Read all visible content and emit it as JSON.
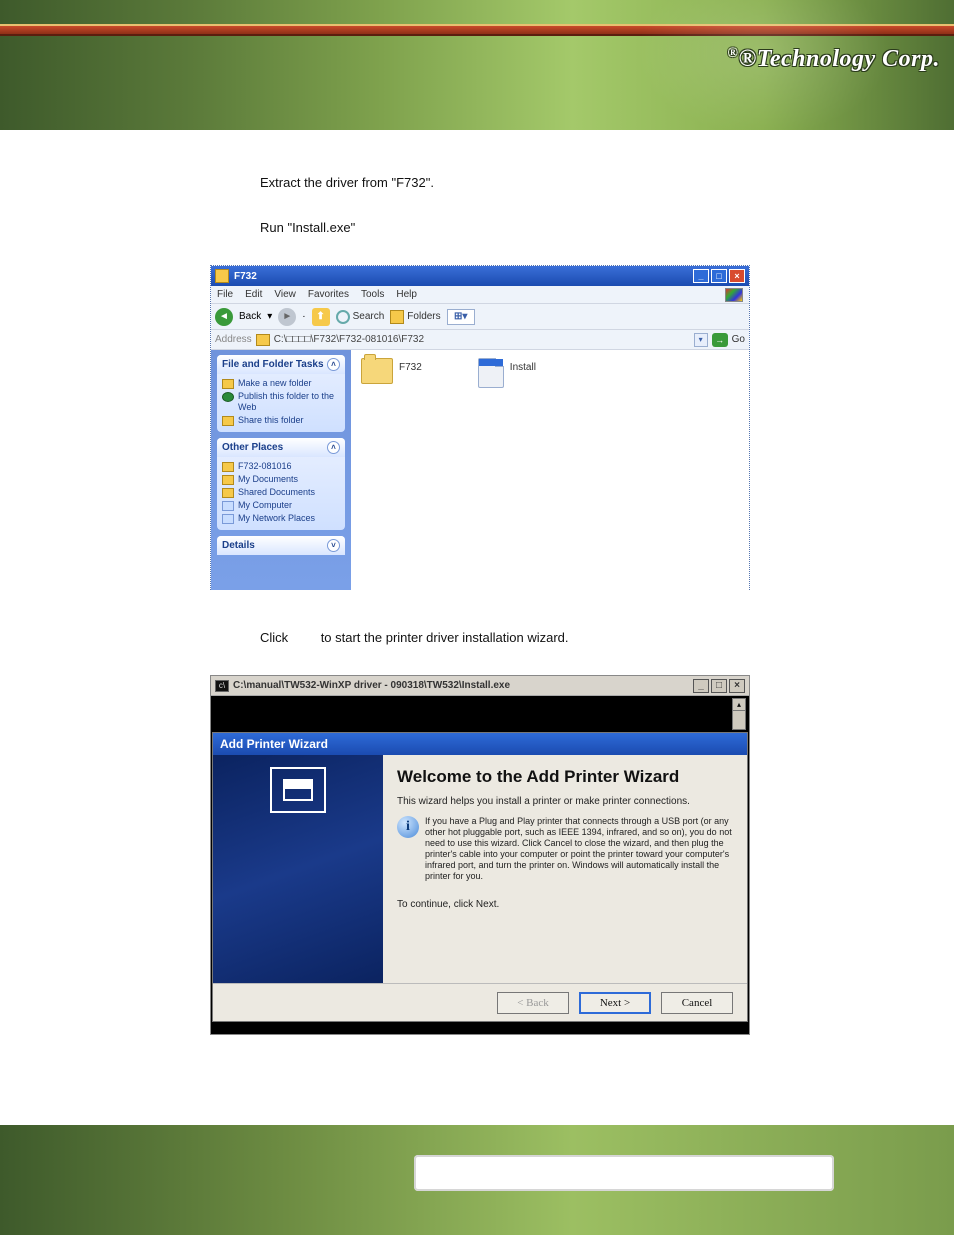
{
  "header": {
    "brand": "®Technology Corp."
  },
  "steps": {
    "extract": "Extract the driver from \"F732\".",
    "run": "Run \"Install.exe\"",
    "click_before": "Click",
    "click_after": "to start the printer driver installation wizard."
  },
  "explorer": {
    "title": "F732",
    "menus": [
      "File",
      "Edit",
      "View",
      "Favorites",
      "Tools",
      "Help"
    ],
    "toolbar": {
      "back": "Back",
      "search": "Search",
      "folders": "Folders",
      "views": "⦿"
    },
    "address": {
      "label": "Address",
      "path": "C:\\□□□□\\F732\\F732-081016\\F732",
      "go": "Go"
    },
    "panels": {
      "tasks": {
        "title": "File and Folder Tasks",
        "items": [
          "Make a new folder",
          "Publish this folder to the Web",
          "Share this folder"
        ]
      },
      "places": {
        "title": "Other Places",
        "items": [
          "F732-081016",
          "My Documents",
          "Shared Documents",
          "My Computer",
          "My Network Places"
        ]
      },
      "details": {
        "title": "Details"
      }
    },
    "items": {
      "folder": "F732",
      "exe": "Install"
    }
  },
  "cmd": {
    "title": "C:\\manual\\TW532-WinXP driver - 090318\\TW532\\Install.exe"
  },
  "wizard": {
    "header": "Add Printer Wizard",
    "welcome": "Welcome to the Add Printer Wizard",
    "intro": "This wizard helps you install a printer or make printer connections.",
    "info": "If you have a Plug and Play printer that connects through a USB port (or any other hot pluggable port, such as IEEE 1394, infrared, and so on), you do not need to use this wizard. Click Cancel to close the wizard, and then plug the printer's cable into your computer or point the printer toward your computer's infrared port, and turn the printer on. Windows will automatically install the printer for you.",
    "continue": "To continue, click Next.",
    "buttons": {
      "back": "< Back",
      "next": "Next >",
      "cancel": "Cancel"
    }
  }
}
